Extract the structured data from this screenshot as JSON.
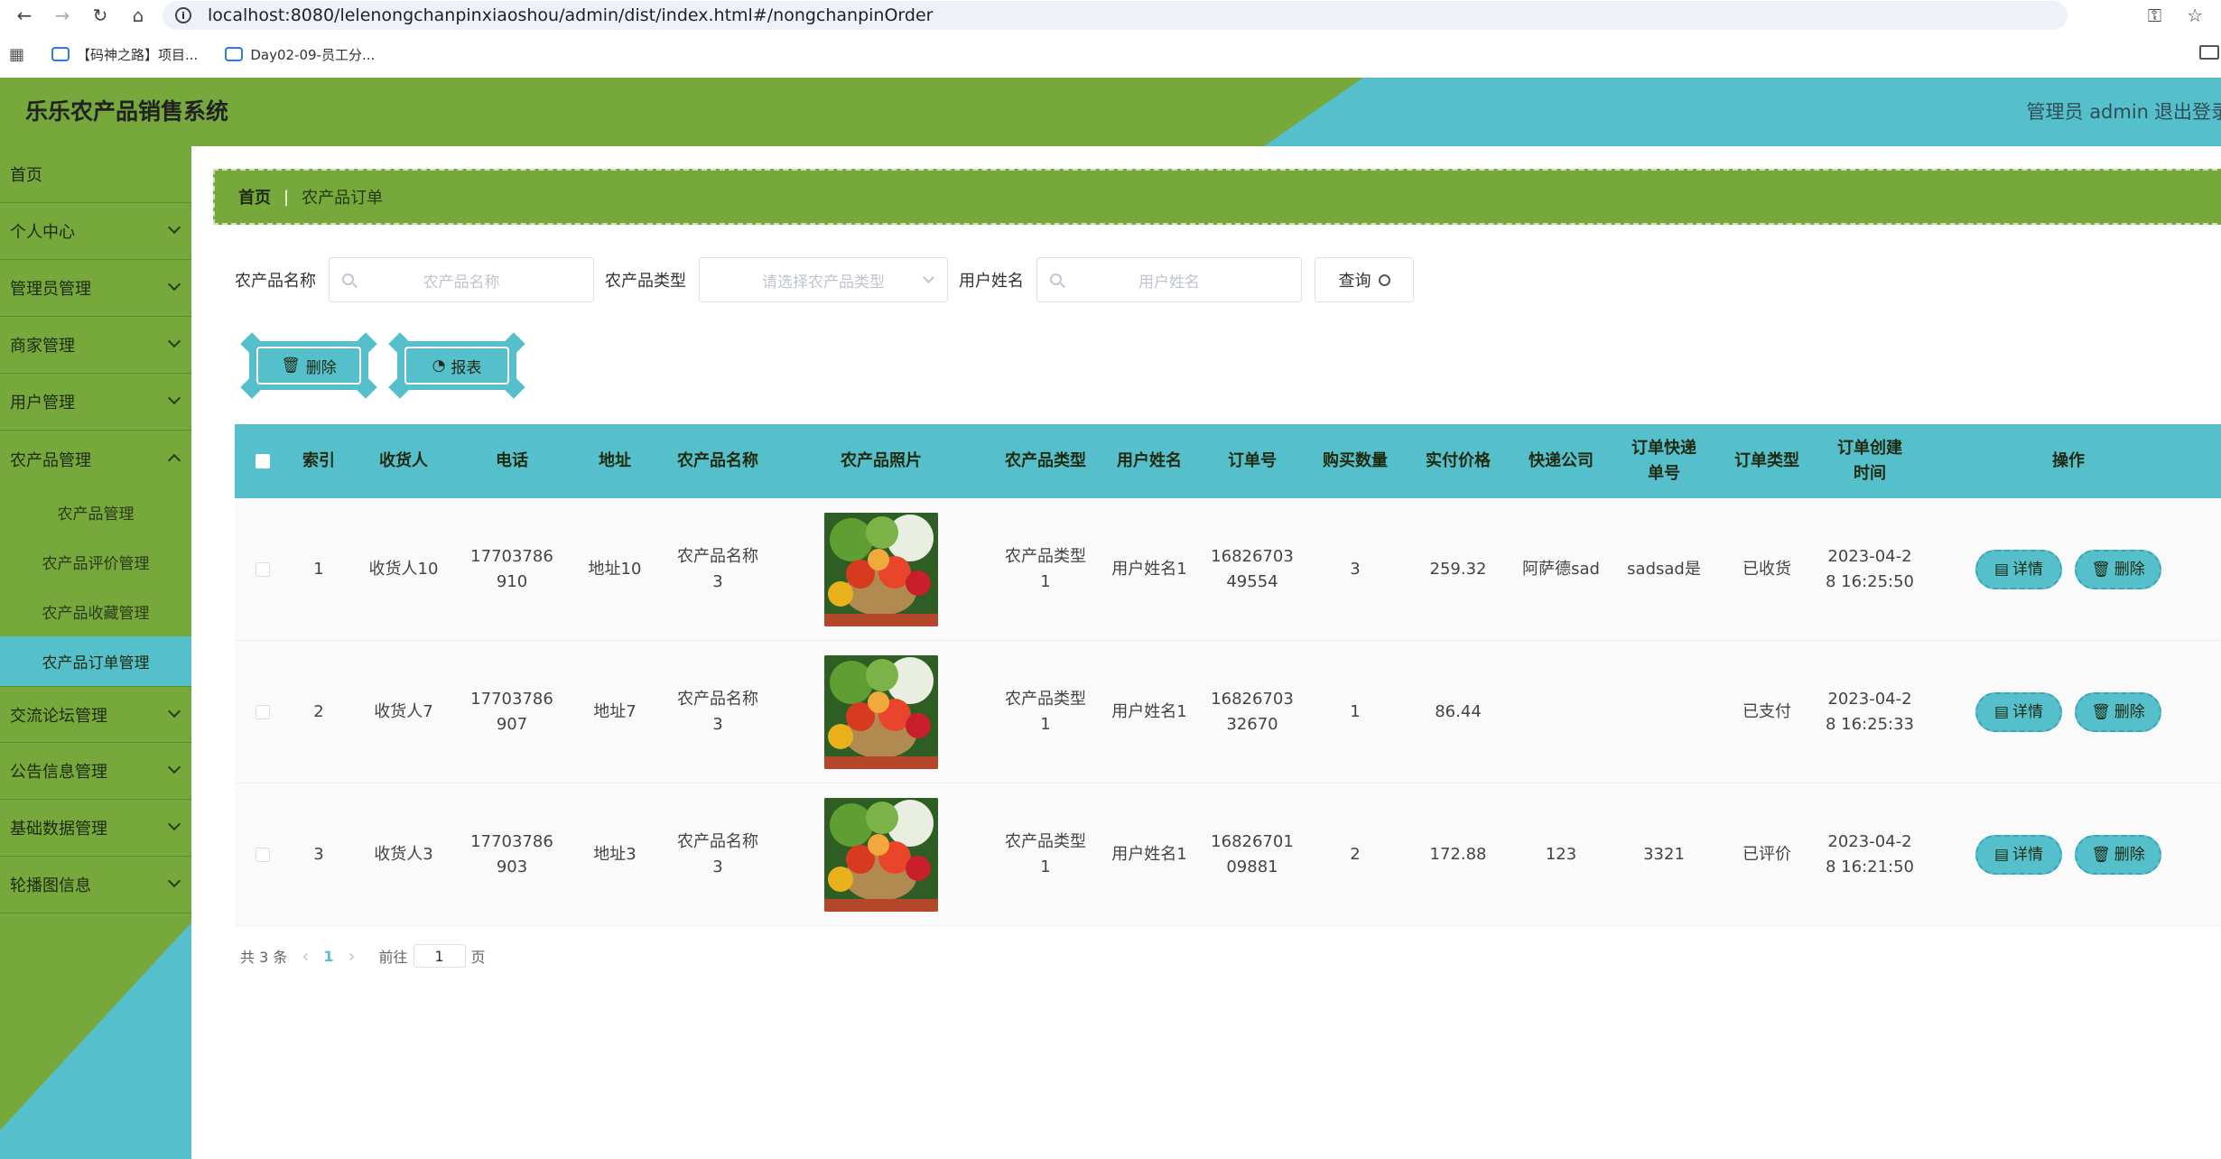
{
  "browser": {
    "url": "localhost:8080/lelenongchanpinxiaoshou/admin/dist/index.html#/nongchanpinOrder",
    "bookmarks": [
      "【码神之路】项目...",
      "Day02-09-员工分..."
    ]
  },
  "header": {
    "title": "乐乐农产品销售系统",
    "user": "管理员 admin",
    "logout": "退出登录"
  },
  "sidebar": {
    "items": [
      {
        "label": "首页"
      },
      {
        "label": "个人中心"
      },
      {
        "label": "管理员管理"
      },
      {
        "label": "商家管理"
      },
      {
        "label": "用户管理"
      },
      {
        "label": "农产品管理"
      }
    ],
    "subitems": [
      {
        "label": "农产品管理"
      },
      {
        "label": "农产品评价管理"
      },
      {
        "label": "农产品收藏管理"
      },
      {
        "label": "农产品订单管理"
      }
    ],
    "items_after": [
      {
        "label": "交流论坛管理"
      },
      {
        "label": "公告信息管理"
      },
      {
        "label": "基础数据管理"
      },
      {
        "label": "轮播图信息"
      }
    ]
  },
  "breadcrumb": {
    "home": "首页",
    "current": "农产品订单"
  },
  "search": {
    "name_label": "农产品名称",
    "name_placeholder": "农产品名称",
    "type_label": "农产品类型",
    "type_placeholder": "请选择农产品类型",
    "user_label": "用户姓名",
    "user_placeholder": "用户姓名",
    "query_label": "查询"
  },
  "actions": {
    "delete_label": "删除",
    "report_label": "报表"
  },
  "table": {
    "headers": [
      "索引",
      "收货人",
      "电话",
      "地址",
      "农产品名称",
      "农产品照片",
      "农产品类型",
      "用户姓名",
      "订单号",
      "购买数量",
      "实付价格",
      "快递公司",
      "订单快递单号",
      "订单类型",
      "订单创建时间",
      "操作"
    ],
    "rows": [
      {
        "index": "1",
        "receiver": "收货人10",
        "phone": "17703786910",
        "address": "地址10",
        "product": "农产品名称3",
        "type": "农产品类型1",
        "user": "用户姓名1",
        "order_no": "1682670349554",
        "qty": "3",
        "price": "259.32",
        "courier": "阿萨德sad",
        "tracking": "sadsad是",
        "status": "已收货",
        "created": "2023-04-28 16:25:50"
      },
      {
        "index": "2",
        "receiver": "收货人7",
        "phone": "17703786907",
        "address": "地址7",
        "product": "农产品名称3",
        "type": "农产品类型1",
        "user": "用户姓名1",
        "order_no": "1682670332670",
        "qty": "1",
        "price": "86.44",
        "courier": "",
        "tracking": "",
        "status": "已支付",
        "created": "2023-04-28 16:25:33"
      },
      {
        "index": "3",
        "receiver": "收货人3",
        "phone": "17703786903",
        "address": "地址3",
        "product": "农产品名称3",
        "type": "农产品类型1",
        "user": "用户姓名1",
        "order_no": "1682670109881",
        "qty": "2",
        "price": "172.88",
        "courier": "123",
        "tracking": "3321",
        "status": "已评价",
        "created": "2023-04-28 16:21:50"
      }
    ],
    "detail_label": "详情",
    "delete_label": "删除"
  },
  "pagination": {
    "total": "共 3 条",
    "current": "1",
    "goto_prefix": "前往",
    "goto_value": "1",
    "goto_suffix": "页"
  },
  "colors": {
    "green": "#76a83c",
    "teal": "#55bfcc"
  }
}
